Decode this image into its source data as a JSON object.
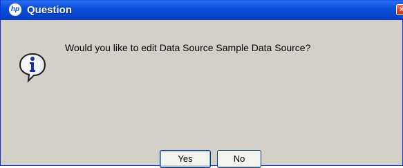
{
  "window": {
    "title": "Question",
    "logo_text": "hp",
    "close_label": "×"
  },
  "icon": {
    "name": "info-icon",
    "glyph": "i"
  },
  "message": "Would you like to edit Data Source Sample Data Source?",
  "buttons": {
    "yes_label": "Yes",
    "no_label": "No"
  }
}
